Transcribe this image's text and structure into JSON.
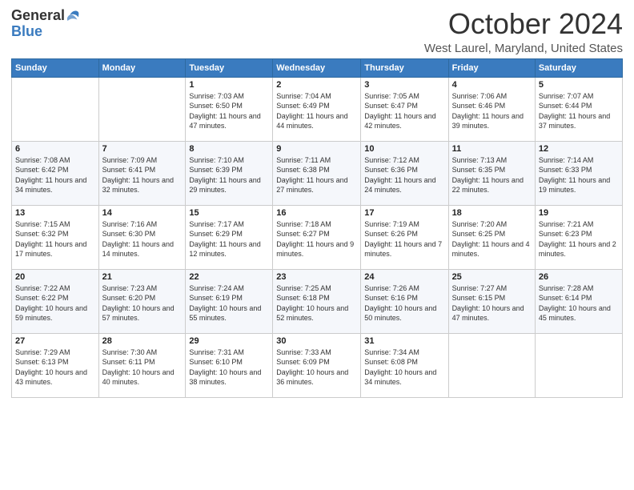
{
  "header": {
    "logo_general": "General",
    "logo_blue": "Blue",
    "month": "October 2024",
    "location": "West Laurel, Maryland, United States"
  },
  "weekdays": [
    "Sunday",
    "Monday",
    "Tuesday",
    "Wednesday",
    "Thursday",
    "Friday",
    "Saturday"
  ],
  "weeks": [
    [
      null,
      null,
      {
        "day": 1,
        "sunrise": "7:03 AM",
        "sunset": "6:50 PM",
        "daylight": "11 hours and 47 minutes."
      },
      {
        "day": 2,
        "sunrise": "7:04 AM",
        "sunset": "6:49 PM",
        "daylight": "11 hours and 44 minutes."
      },
      {
        "day": 3,
        "sunrise": "7:05 AM",
        "sunset": "6:47 PM",
        "daylight": "11 hours and 42 minutes."
      },
      {
        "day": 4,
        "sunrise": "7:06 AM",
        "sunset": "6:46 PM",
        "daylight": "11 hours and 39 minutes."
      },
      {
        "day": 5,
        "sunrise": "7:07 AM",
        "sunset": "6:44 PM",
        "daylight": "11 hours and 37 minutes."
      }
    ],
    [
      {
        "day": 6,
        "sunrise": "7:08 AM",
        "sunset": "6:42 PM",
        "daylight": "11 hours and 34 minutes."
      },
      {
        "day": 7,
        "sunrise": "7:09 AM",
        "sunset": "6:41 PM",
        "daylight": "11 hours and 32 minutes."
      },
      {
        "day": 8,
        "sunrise": "7:10 AM",
        "sunset": "6:39 PM",
        "daylight": "11 hours and 29 minutes."
      },
      {
        "day": 9,
        "sunrise": "7:11 AM",
        "sunset": "6:38 PM",
        "daylight": "11 hours and 27 minutes."
      },
      {
        "day": 10,
        "sunrise": "7:12 AM",
        "sunset": "6:36 PM",
        "daylight": "11 hours and 24 minutes."
      },
      {
        "day": 11,
        "sunrise": "7:13 AM",
        "sunset": "6:35 PM",
        "daylight": "11 hours and 22 minutes."
      },
      {
        "day": 12,
        "sunrise": "7:14 AM",
        "sunset": "6:33 PM",
        "daylight": "11 hours and 19 minutes."
      }
    ],
    [
      {
        "day": 13,
        "sunrise": "7:15 AM",
        "sunset": "6:32 PM",
        "daylight": "11 hours and 17 minutes."
      },
      {
        "day": 14,
        "sunrise": "7:16 AM",
        "sunset": "6:30 PM",
        "daylight": "11 hours and 14 minutes."
      },
      {
        "day": 15,
        "sunrise": "7:17 AM",
        "sunset": "6:29 PM",
        "daylight": "11 hours and 12 minutes."
      },
      {
        "day": 16,
        "sunrise": "7:18 AM",
        "sunset": "6:27 PM",
        "daylight": "11 hours and 9 minutes."
      },
      {
        "day": 17,
        "sunrise": "7:19 AM",
        "sunset": "6:26 PM",
        "daylight": "11 hours and 7 minutes."
      },
      {
        "day": 18,
        "sunrise": "7:20 AM",
        "sunset": "6:25 PM",
        "daylight": "11 hours and 4 minutes."
      },
      {
        "day": 19,
        "sunrise": "7:21 AM",
        "sunset": "6:23 PM",
        "daylight": "11 hours and 2 minutes."
      }
    ],
    [
      {
        "day": 20,
        "sunrise": "7:22 AM",
        "sunset": "6:22 PM",
        "daylight": "10 hours and 59 minutes."
      },
      {
        "day": 21,
        "sunrise": "7:23 AM",
        "sunset": "6:20 PM",
        "daylight": "10 hours and 57 minutes."
      },
      {
        "day": 22,
        "sunrise": "7:24 AM",
        "sunset": "6:19 PM",
        "daylight": "10 hours and 55 minutes."
      },
      {
        "day": 23,
        "sunrise": "7:25 AM",
        "sunset": "6:18 PM",
        "daylight": "10 hours and 52 minutes."
      },
      {
        "day": 24,
        "sunrise": "7:26 AM",
        "sunset": "6:16 PM",
        "daylight": "10 hours and 50 minutes."
      },
      {
        "day": 25,
        "sunrise": "7:27 AM",
        "sunset": "6:15 PM",
        "daylight": "10 hours and 47 minutes."
      },
      {
        "day": 26,
        "sunrise": "7:28 AM",
        "sunset": "6:14 PM",
        "daylight": "10 hours and 45 minutes."
      }
    ],
    [
      {
        "day": 27,
        "sunrise": "7:29 AM",
        "sunset": "6:13 PM",
        "daylight": "10 hours and 43 minutes."
      },
      {
        "day": 28,
        "sunrise": "7:30 AM",
        "sunset": "6:11 PM",
        "daylight": "10 hours and 40 minutes."
      },
      {
        "day": 29,
        "sunrise": "7:31 AM",
        "sunset": "6:10 PM",
        "daylight": "10 hours and 38 minutes."
      },
      {
        "day": 30,
        "sunrise": "7:33 AM",
        "sunset": "6:09 PM",
        "daylight": "10 hours and 36 minutes."
      },
      {
        "day": 31,
        "sunrise": "7:34 AM",
        "sunset": "6:08 PM",
        "daylight": "10 hours and 34 minutes."
      },
      null,
      null
    ]
  ],
  "labels": {
    "sunrise": "Sunrise:",
    "sunset": "Sunset:",
    "daylight": "Daylight:"
  }
}
